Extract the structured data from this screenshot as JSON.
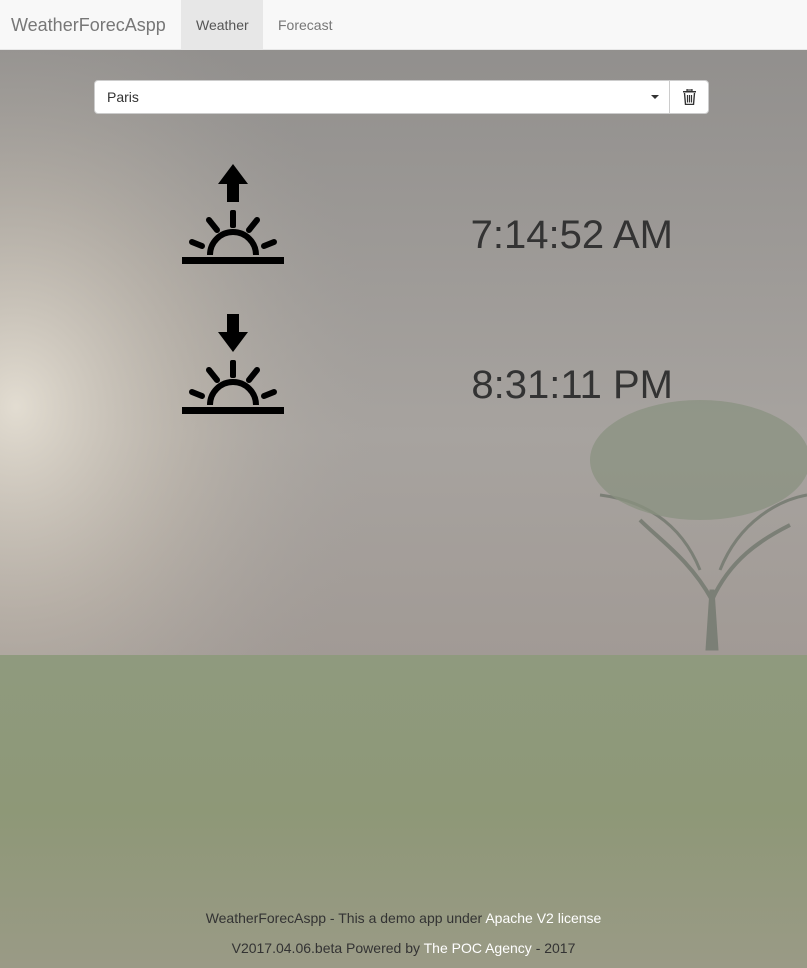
{
  "navbar": {
    "brand": "WeatherForecAspp",
    "tabs": [
      {
        "label": "Weather",
        "active": true
      },
      {
        "label": "Forecast",
        "active": false
      }
    ]
  },
  "city_select": {
    "value": "Paris",
    "caret_icon": "chevron-down-icon",
    "delete_icon": "trash-icon"
  },
  "sun": {
    "sunrise": {
      "icon": "sunrise-icon",
      "time": "7:14:52 AM"
    },
    "sunset": {
      "icon": "sunset-icon",
      "time": "8:31:11 PM"
    }
  },
  "footer": {
    "line1_prefix": "WeatherForecAspp - This a demo app under",
    "license_link": "Apache V2 license",
    "line2_prefix": "V2017.04.06.beta Powered by",
    "agency_link": "The POC Agency",
    "line2_suffix": "- 2017"
  },
  "colors": {
    "navbar_bg": "#f8f8f8",
    "active_tab_bg": "#e7e7e7",
    "text_dark": "#333333",
    "link_white": "#ffffff"
  }
}
